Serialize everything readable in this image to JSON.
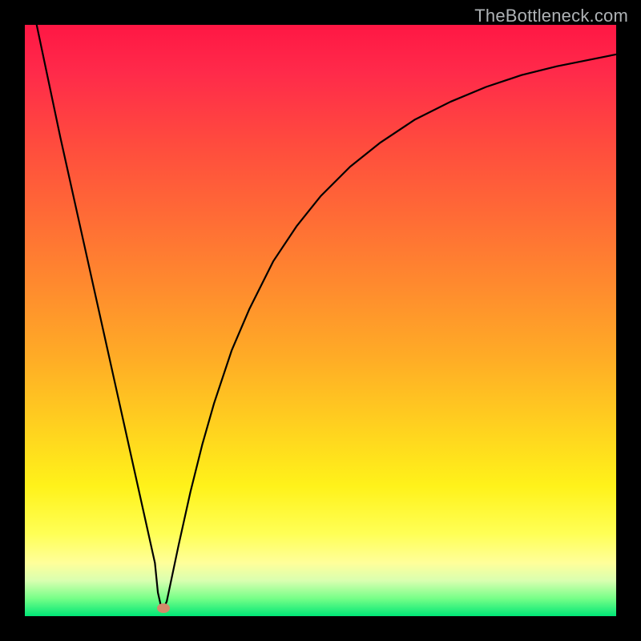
{
  "watermark": "TheBottleneck.com",
  "chart_data": {
    "type": "line",
    "title": "",
    "xlabel": "",
    "ylabel": "",
    "xlim": [
      0,
      100
    ],
    "ylim": [
      0,
      100
    ],
    "series": [
      {
        "name": "curve",
        "x": [
          2,
          4,
          6,
          8,
          10,
          12,
          14,
          16,
          18,
          20,
          22,
          22.5,
          23,
          23.5,
          24,
          26,
          28,
          30,
          32,
          35,
          38,
          42,
          46,
          50,
          55,
          60,
          66,
          72,
          78,
          84,
          90,
          95,
          100
        ],
        "y": [
          100,
          90.5,
          81,
          72,
          63,
          54,
          45,
          36,
          27,
          18,
          9,
          4,
          1.8,
          1.4,
          2.5,
          12,
          21,
          29,
          36,
          45,
          52,
          60,
          66,
          71,
          76,
          80,
          84,
          87,
          89.5,
          91.5,
          93,
          94,
          95
        ]
      }
    ],
    "marker": {
      "x": 23.5,
      "y": 1.4
    },
    "colors": {
      "curve": "#000000",
      "marker": "#d48a6a",
      "gradient_top": "#ff1744",
      "gradient_bottom": "#00e676"
    }
  }
}
